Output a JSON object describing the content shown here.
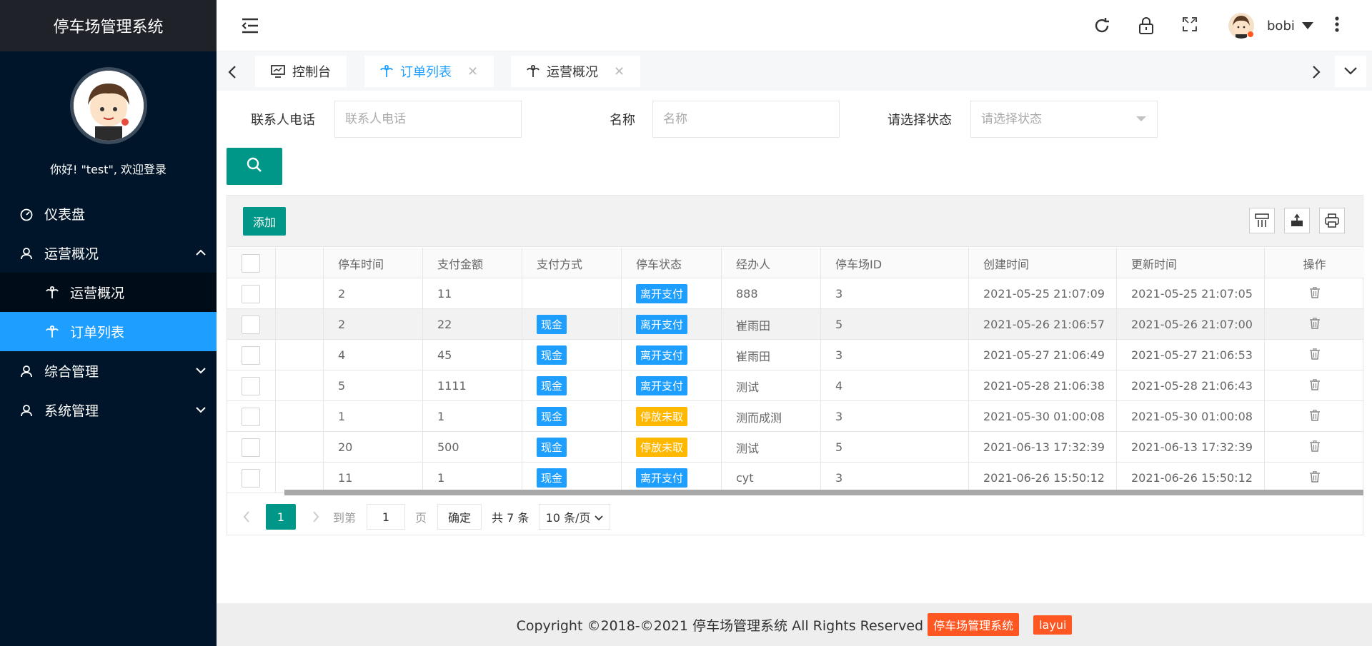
{
  "app": {
    "title": "停车场管理系统"
  },
  "sidebar": {
    "welcome": "你好!  \"test\", 欢迎登录",
    "items": [
      {
        "label": "仪表盘",
        "icon": "dashboard-icon"
      },
      {
        "label": "运营概况",
        "icon": "user-icon"
      },
      {
        "label": "运营概况",
        "icon": "palm-icon"
      },
      {
        "label": "订单列表",
        "icon": "palm-icon"
      },
      {
        "label": "综合管理",
        "icon": "user-icon"
      },
      {
        "label": "系统管理",
        "icon": "user-icon"
      }
    ]
  },
  "header": {
    "username": "bobi"
  },
  "tabs": [
    {
      "label": "控制台"
    },
    {
      "label": "订单列表"
    },
    {
      "label": "运营概况"
    }
  ],
  "search": {
    "phone_label": "联系人电话",
    "phone_placeholder": "联系人电话",
    "name_label": "名称",
    "name_placeholder": "名称",
    "status_label": "请选择状态",
    "status_placeholder": "请选择状态"
  },
  "toolbar": {
    "add_label": "添加"
  },
  "table": {
    "columns": [
      "停车时间",
      "支付金额",
      "支付方式",
      "停车状态",
      "经办人",
      "停车场ID",
      "创建时间",
      "更新时间",
      "操作"
    ],
    "rows": [
      {
        "time": "2",
        "amount": "11",
        "method": "",
        "status": "离开支付",
        "status_color": "blue",
        "agent": "888",
        "lot": "3",
        "created": "2021-05-25 21:07:09",
        "updated": "2021-05-25 21:07:05"
      },
      {
        "time": "2",
        "amount": "22",
        "method": "现金",
        "status": "离开支付",
        "status_color": "blue",
        "agent": "崔雨田",
        "lot": "5",
        "created": "2021-05-26 21:06:57",
        "updated": "2021-05-26 21:07:00"
      },
      {
        "time": "4",
        "amount": "45",
        "method": "现金",
        "status": "离开支付",
        "status_color": "blue",
        "agent": "崔雨田",
        "lot": "3",
        "created": "2021-05-27 21:06:49",
        "updated": "2021-05-27 21:06:53"
      },
      {
        "time": "5",
        "amount": "1111",
        "method": "现金",
        "status": "离开支付",
        "status_color": "blue",
        "agent": "测试",
        "lot": "4",
        "created": "2021-05-28 21:06:38",
        "updated": "2021-05-28 21:06:43"
      },
      {
        "time": "1",
        "amount": "1",
        "method": "现金",
        "status": "停放未取",
        "status_color": "orange",
        "agent": "测而成测",
        "lot": "3",
        "created": "2021-05-30 01:00:08",
        "updated": "2021-05-30 01:00:08"
      },
      {
        "time": "20",
        "amount": "500",
        "method": "现金",
        "status": "停放未取",
        "status_color": "orange",
        "agent": "测试",
        "lot": "5",
        "created": "2021-06-13 17:32:39",
        "updated": "2021-06-13 17:32:39"
      },
      {
        "time": "11",
        "amount": "1",
        "method": "现金",
        "status": "离开支付",
        "status_color": "blue",
        "agent": "cyt",
        "lot": "3",
        "created": "2021-06-26 15:50:12",
        "updated": "2021-06-26 15:50:12"
      }
    ]
  },
  "pager": {
    "current": "1",
    "goto_label": "到第",
    "goto_value": "1",
    "page_label": "页",
    "confirm_label": "确定",
    "total_label": "共 7 条",
    "per_page": "10 条/页"
  },
  "footer": {
    "copyright": "Copyright ©2018-©2021 停车场管理系统 All Rights Reserved",
    "tag1": "停车场管理系统",
    "tag2": "layui"
  },
  "colors": {
    "teal": "#009688",
    "blue": "#1e9fff",
    "orange": "#ffb800",
    "sidebar": "#001529",
    "footer_tag": "#ff5722"
  }
}
